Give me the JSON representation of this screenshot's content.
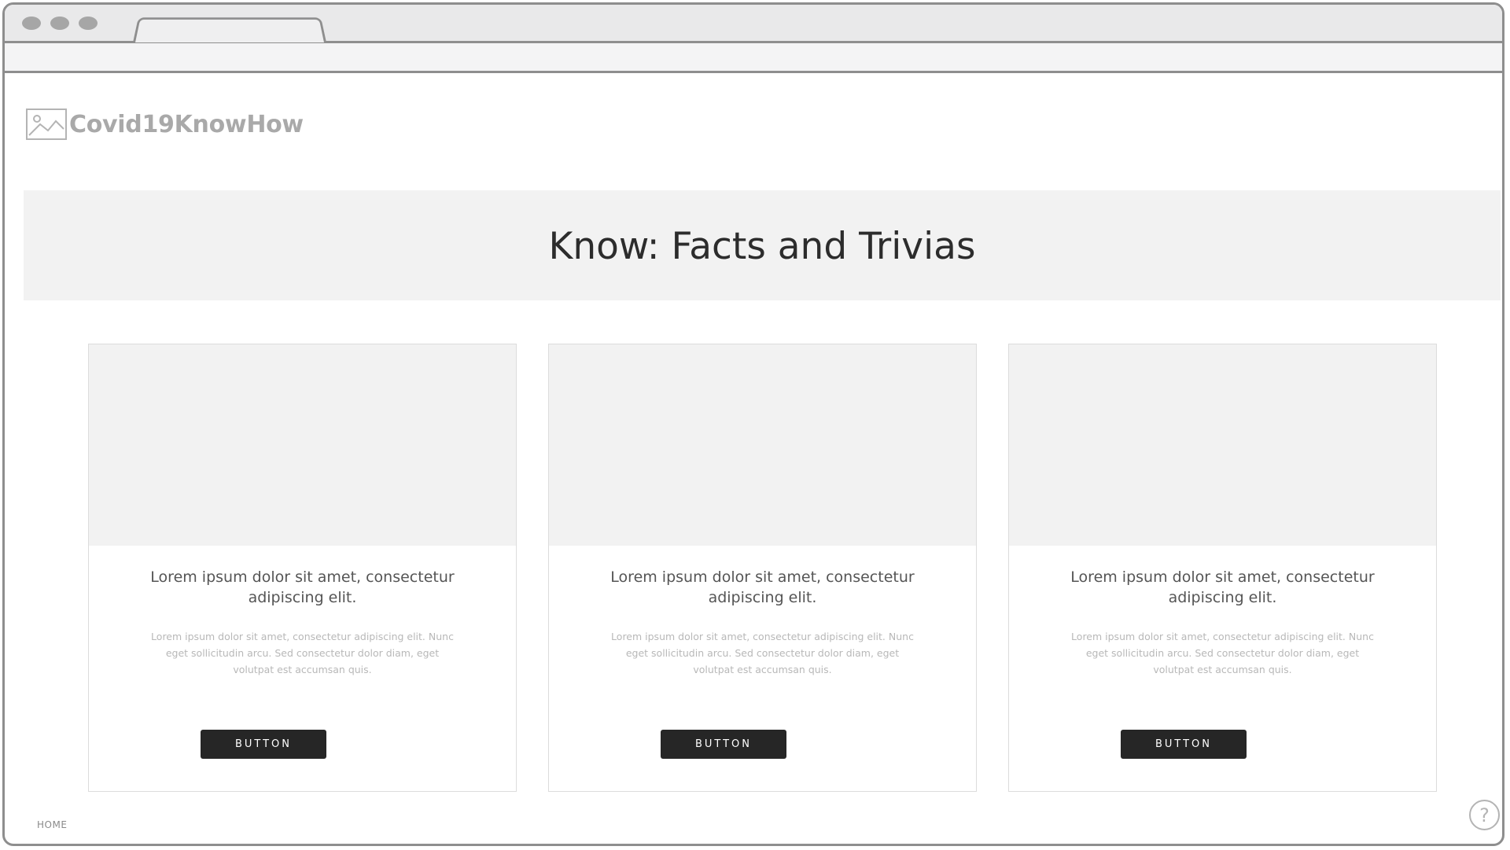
{
  "window": {
    "controls": [
      "window-dot-close",
      "window-dot-minimize",
      "window-dot-maximize"
    ],
    "tab_title": "",
    "address": ""
  },
  "header": {
    "logo_icon": "image-placeholder-icon",
    "logo_text": "Covid19KnowHow"
  },
  "banner": {
    "title": "Know: Facts and Trivias"
  },
  "cards": [
    {
      "title": "Lorem ipsum dolor sit amet, consectetur adipiscing elit.",
      "text": "Lorem ipsum dolor sit amet, consectetur adipiscing elit. Nunc eget sollicitudin arcu. Sed consectetur dolor diam, eget volutpat est accumsan quis.",
      "button_label": "BUTTON"
    },
    {
      "title": "Lorem ipsum dolor sit amet, consectetur adipiscing elit.",
      "text": "Lorem ipsum dolor sit amet, consectetur adipiscing elit. Nunc eget sollicitudin arcu. Sed consectetur dolor diam, eget volutpat est accumsan quis.",
      "button_label": "BUTTON"
    },
    {
      "title": "Lorem ipsum dolor sit amet, consectetur adipiscing elit.",
      "text": "Lorem ipsum dolor sit amet, consectetur adipiscing elit. Nunc eget sollicitudin arcu. Sed consectetur dolor diam, eget volutpat est accumsan quis.",
      "button_label": "BUTTON"
    }
  ],
  "footer": {
    "home_label": "HOME",
    "help_icon": "help-icon",
    "help_glyph": "?"
  },
  "colors": {
    "button_bg": "#262626",
    "banner_bg": "#f2f2f2",
    "frame": "#8e8e8e"
  }
}
